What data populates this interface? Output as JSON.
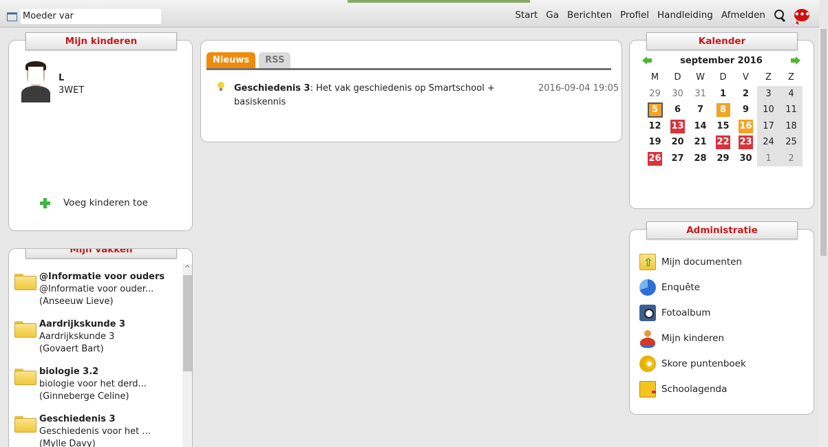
{
  "topbar": {
    "school_name": "Moeder var",
    "nav": [
      "Start",
      "Ga",
      "Berichten",
      "Profiel",
      "Handleiding",
      "Afmelden"
    ],
    "search_icon": "search-icon",
    "chat_icon": "chat-icon",
    "chat_icon_color": "#d01010"
  },
  "kinderen": {
    "title": "Mijn kinderen",
    "child": {
      "name": "L",
      "class": "3WET"
    },
    "add_label": "Voeg kinderen toe"
  },
  "vakken": {
    "title": "Mijn vakken",
    "items": [
      {
        "title": "@Informatie voor ouders",
        "subtitle": "@Informatie voor ouder...",
        "teacher": "(Anseeuw Lieve)"
      },
      {
        "title": "Aardrijkskunde 3",
        "subtitle": "Aardrijkskunde 3",
        "teacher": "(Govaert Bart)"
      },
      {
        "title": "biologie 3.2",
        "subtitle": "biologie voor het derd...",
        "teacher": "(Ginneberge Celine)"
      },
      {
        "title": "Geschiedenis 3",
        "subtitle": "Geschiedenis voor het ...",
        "teacher": "(Mylle Davy)"
      }
    ]
  },
  "nieuws": {
    "tabs": [
      "Nieuws",
      "RSS"
    ],
    "active_tab": "Nieuws",
    "accent_color": "#ef8a0a",
    "item": {
      "title": "Geschiedenis 3",
      "text": ": Het vak geschiedenis op Smartschool + basiskennis",
      "date": "2016-09-04 19:05"
    }
  },
  "kalender": {
    "title": "Kalender",
    "month": "september 2016",
    "weekdays": [
      "M",
      "D",
      "W",
      "D",
      "V",
      "Z",
      "Z"
    ],
    "weeks": [
      [
        "29",
        "30",
        "31",
        "1",
        "2",
        "3",
        "4"
      ],
      [
        "5",
        "6",
        "7",
        "8",
        "9",
        "10",
        "11"
      ],
      [
        "12",
        "13",
        "14",
        "15",
        "16",
        "17",
        "18"
      ],
      [
        "19",
        "20",
        "21",
        "22",
        "23",
        "24",
        "25"
      ],
      [
        "26",
        "27",
        "28",
        "29",
        "30",
        "1",
        "2"
      ]
    ],
    "red_days": [
      "13",
      "22",
      "23",
      "26"
    ],
    "orange_days": [
      "8",
      "16"
    ],
    "today": "5",
    "red_color": "#d9333c",
    "orange_color": "#f2a423"
  },
  "administratie": {
    "title": "Administratie",
    "items": [
      {
        "label": "Mijn documenten",
        "icon": "documents-icon"
      },
      {
        "label": "Enquête",
        "icon": "survey-icon"
      },
      {
        "label": "Fotoalbum",
        "icon": "photo-album-icon"
      },
      {
        "label": "Mijn kinderen",
        "icon": "children-icon"
      },
      {
        "label": "Skore puntenboek",
        "icon": "gradebook-icon"
      },
      {
        "label": "Schoolagenda",
        "icon": "agenda-icon"
      }
    ]
  }
}
